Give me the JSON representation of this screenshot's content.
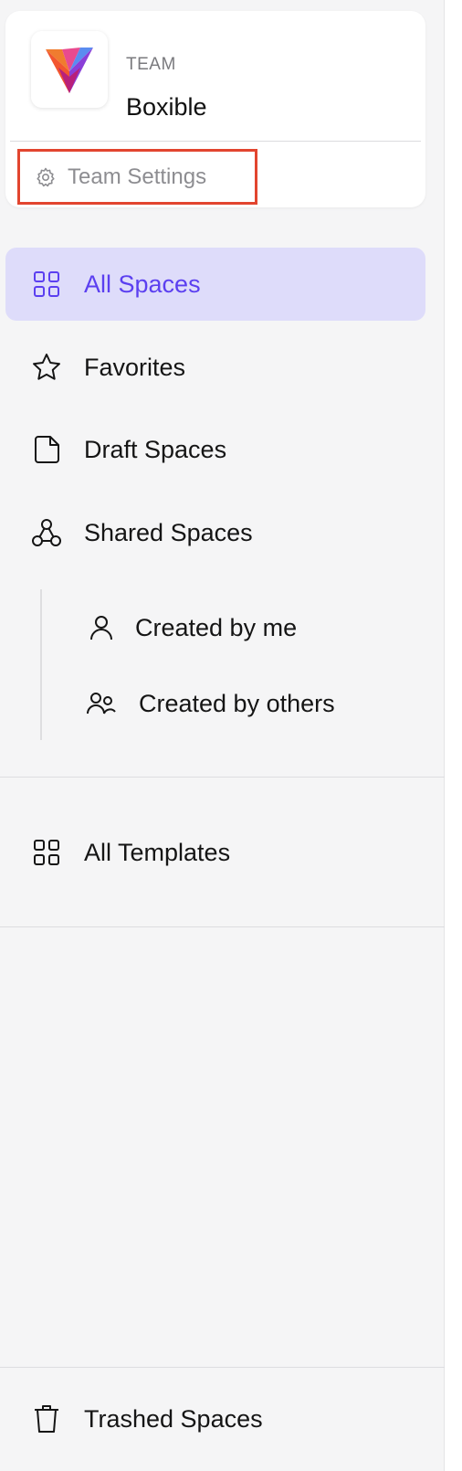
{
  "team": {
    "kicker": "TEAM",
    "name": "Boxible",
    "settings_label": "Team Settings"
  },
  "nav": {
    "all_spaces": "All Spaces",
    "favorites": "Favorites",
    "draft_spaces": "Draft Spaces",
    "shared_spaces": "Shared Spaces",
    "created_by_me": "Created by me",
    "created_by_others": "Created by others",
    "all_templates": "All Templates",
    "trashed_spaces": "Trashed Spaces"
  },
  "icons": {
    "team_logo": "v-logo",
    "settings": "gear-icon",
    "all_spaces": "grid-icon",
    "favorites": "star-icon",
    "draft_spaces": "document-icon",
    "shared_spaces": "network-icon",
    "created_by_me": "user-icon",
    "created_by_others": "users-icon",
    "all_templates": "grid-icon",
    "trashed_spaces": "trash-icon"
  },
  "colors": {
    "accent": "#5b3ff0",
    "active_bg": "#dedcfa",
    "highlight_border": "#e2452f",
    "sidebar_bg": "#f5f5f6"
  }
}
